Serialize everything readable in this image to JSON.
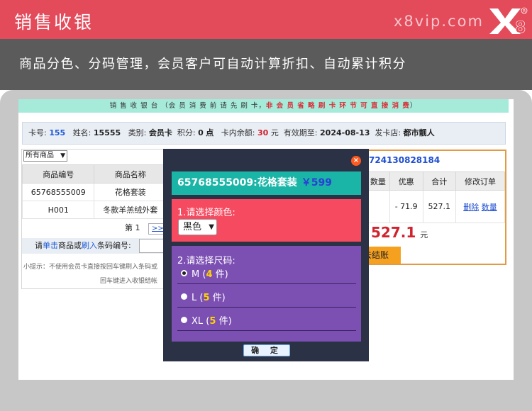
{
  "header": {
    "title": "销售收银",
    "site": "x8vip.com",
    "logo_text": "X8"
  },
  "banner": {
    "text": "商品分色、分码管理，会员客户可自动计算折扣、自动累计积分"
  },
  "notice": {
    "normal": "销 售 收 银 台 （会 员 消 费 前 请 先 刷 卡，",
    "warn": "非 会 员 省 略 刷 卡 环 节 可 直 接 消 费",
    "end": "）"
  },
  "member": {
    "card_label": "卡号:",
    "card_no": "155",
    "name_label": "姓名:",
    "name": "15555",
    "type_label": "类别:",
    "type": "会员卡",
    "points_label": "积分:",
    "points": "0",
    "points_unit": "点",
    "balance_label": "卡内余额:",
    "balance": "30",
    "balance_unit": "元",
    "expiry_label": "有效期至:",
    "expiry": "2024-08-13",
    "store_label": "发卡店:",
    "store": "都市靓人"
  },
  "products": {
    "filter_value": "所有商品",
    "columns": [
      "商品编号",
      "商品名称"
    ],
    "rows": [
      {
        "code": "65768555009",
        "name": "花格套装"
      },
      {
        "code": "H001",
        "name": "冬款羊羔绒外套"
      }
    ],
    "page_label": "第 1",
    "next_label": ">>"
  },
  "scan": {
    "prefix": "请",
    "click": "单击",
    "mid1": "商品或",
    "swipe": "刷入",
    "mid2": "条码编号:",
    "tip1": "小提示：不使用会员卡直接按回车键刷入条码或",
    "tip2": "回车键进入收银结帐"
  },
  "order": {
    "card_no_partial": "724130828184",
    "columns": [
      "数量",
      "优惠",
      "合计",
      "修改订单"
    ],
    "row": {
      "discount": "- 71.9",
      "subtotal": "527.1",
      "delete": "删除",
      "qty": "数量"
    },
    "total": "527.1",
    "total_unit": "元",
    "settle_label": "去结账"
  },
  "modal": {
    "close": "×",
    "product": "65768555009:花格套装",
    "price": "￥599",
    "color_label": "1.请选择颜色:",
    "color_value": "黑色",
    "size_label": "2.请选择尺码:",
    "sizes": [
      {
        "size": "M",
        "open": "(",
        "count": "4",
        "unit": "件)",
        "selected": true
      },
      {
        "size": "L",
        "open": "(",
        "count": "5",
        "unit": "件)",
        "selected": false
      },
      {
        "size": "XL",
        "open": "(",
        "count": "5",
        "unit": "件)",
        "selected": false
      }
    ],
    "confirm": "确 定"
  }
}
